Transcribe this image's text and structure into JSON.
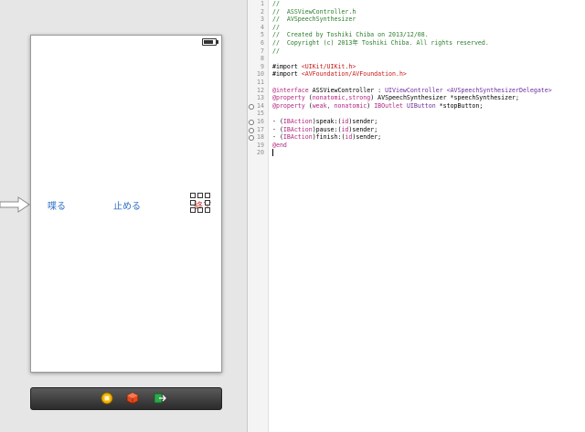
{
  "ib": {
    "buttons": {
      "speak": "喋る",
      "pause": "止める",
      "stop": "終了"
    }
  },
  "code_lines": [
    {
      "n": "1",
      "t": "//",
      "c": "cmt"
    },
    {
      "n": "2",
      "t": "//  ASSViewController.h",
      "c": "cmt"
    },
    {
      "n": "3",
      "t": "//  AVSpeechSynthesizer",
      "c": "cmt"
    },
    {
      "n": "4",
      "t": "//",
      "c": "cmt"
    },
    {
      "n": "5",
      "t": "//  Created by Toshiki Chiba on 2013/12/08.",
      "c": "cmt"
    },
    {
      "n": "6",
      "t": "//  Copyright (c) 2013年 Toshiki Chiba. All rights reserved.",
      "c": "cmt"
    },
    {
      "n": "7",
      "t": "//",
      "c": "cmt"
    },
    {
      "n": "8",
      "t": "",
      "c": ""
    },
    {
      "n": "9",
      "t": "#import <UIKit/UIKit.h>",
      "c": "import"
    },
    {
      "n": "10",
      "t": "#import <AVFoundation/AVFoundation.h>",
      "c": "import"
    },
    {
      "n": "11",
      "t": "",
      "c": ""
    },
    {
      "n": "12",
      "t": "@interface ASSViewController : UIViewController <AVSpeechSynthesizerDelegate>",
      "c": "iface"
    },
    {
      "n": "13",
      "t": "@property (nonatomic,strong) AVSpeechSynthesizer *speechSynthesizer;",
      "c": "prop1"
    },
    {
      "n": "14",
      "t": "@property (weak, nonatomic) IBOutlet UIButton *stopButton;",
      "c": "prop2",
      "marker": true
    },
    {
      "n": "15",
      "t": "",
      "c": ""
    },
    {
      "n": "16",
      "t": "- (IBAction)speak:(id)sender;",
      "c": "act",
      "marker": true
    },
    {
      "n": "17",
      "t": "- (IBAction)pause:(id)sender;",
      "c": "act",
      "marker": true
    },
    {
      "n": "18",
      "t": "- (IBAction)finish:(id)sender;",
      "c": "act",
      "marker": true
    },
    {
      "n": "19",
      "t": "@end",
      "c": "end"
    },
    {
      "n": "20",
      "t": "",
      "c": "cursor"
    }
  ],
  "icons": {
    "first_responder": "first-responder-icon",
    "object": "object-cube-icon",
    "exit": "exit-icon"
  }
}
